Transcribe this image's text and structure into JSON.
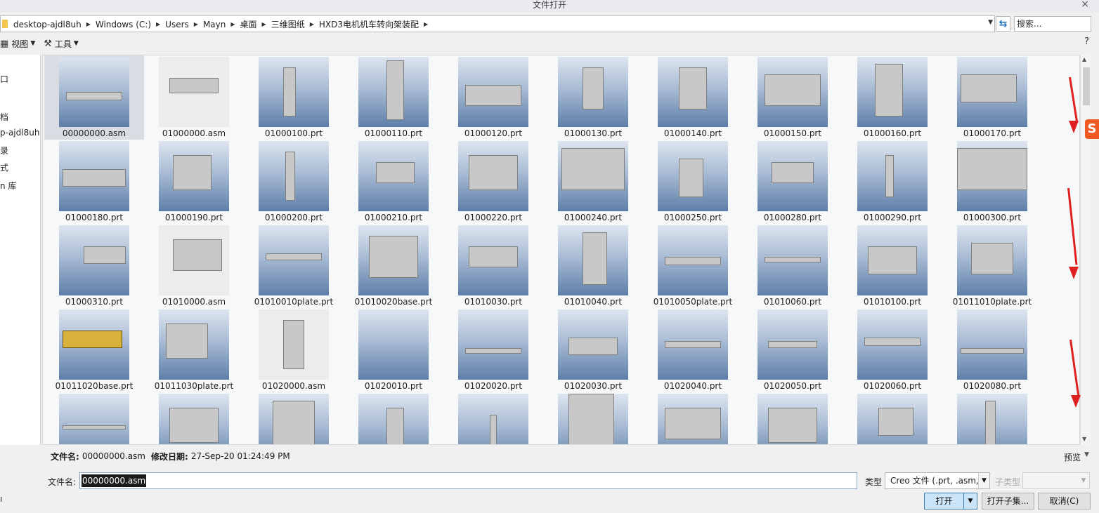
{
  "window": {
    "title": "文件打开",
    "close_glyph": "×"
  },
  "address_bar": {
    "crumbs": [
      "desktop-ajdl8uh",
      "Windows (C:)",
      "Users",
      "Mayn",
      "桌面",
      "三维图纸",
      "HXD3电机机车转向架装配"
    ],
    "search_placeholder": "搜索..."
  },
  "toolbar": {
    "view_label": "视图",
    "tools_label": "工具",
    "help_glyph": "?"
  },
  "sidebar": {
    "items": [
      "口",
      "",
      "档",
      "p-ajdl8uh",
      "录",
      "式",
      "n 库"
    ]
  },
  "files": [
    "00000000.asm",
    "01000000.asm",
    "01000100.prt",
    "01000110.prt",
    "01000120.prt",
    "01000130.prt",
    "01000140.prt",
    "01000150.prt",
    "01000160.prt",
    "01000170.prt",
    "01000180.prt",
    "01000190.prt",
    "01000200.prt",
    "01000210.prt",
    "01000220.prt",
    "01000240.prt",
    "01000250.prt",
    "01000280.prt",
    "01000290.prt",
    "01000300.prt",
    "01000310.prt",
    "01010000.asm",
    "01010010plate.prt",
    "01010020base.prt",
    "01010030.prt",
    "01010040.prt",
    "01010050plate.prt",
    "01010060.prt",
    "01010100.prt",
    "01011010plate.prt",
    "01011020base.prt",
    "01011030plate.prt",
    "01020000.asm",
    "01020010.prt",
    "01020020.prt",
    "01020030.prt",
    "01020040.prt",
    "01020050.prt",
    "01020060.prt",
    "01020080.prt",
    "",
    "",
    "",
    "",
    "",
    "",
    "",
    "",
    "",
    ""
  ],
  "selected_index": 0,
  "light_thumbs": [
    1,
    21,
    32
  ],
  "info": {
    "filename_label": "文件名:",
    "filename_value": "00000000.asm",
    "modified_label": "修改日期:",
    "modified_value": "27-Sep-20 01:24:49 PM",
    "preview_label": "预览"
  },
  "form": {
    "filename_label": "文件名:",
    "filename_value": "00000000.asm",
    "type_label": "类型",
    "type_value": "Creo 文件 (.prt, .asm,",
    "subtype_label": "子类型"
  },
  "buttons": {
    "open": "打开",
    "open_sub": "打开子集...",
    "cancel": "取消(C)"
  },
  "overlay": {
    "sogou_glyph": "S"
  },
  "colors": {
    "accent": "#3c7fb1",
    "annotation_arrow": "#e02020"
  }
}
